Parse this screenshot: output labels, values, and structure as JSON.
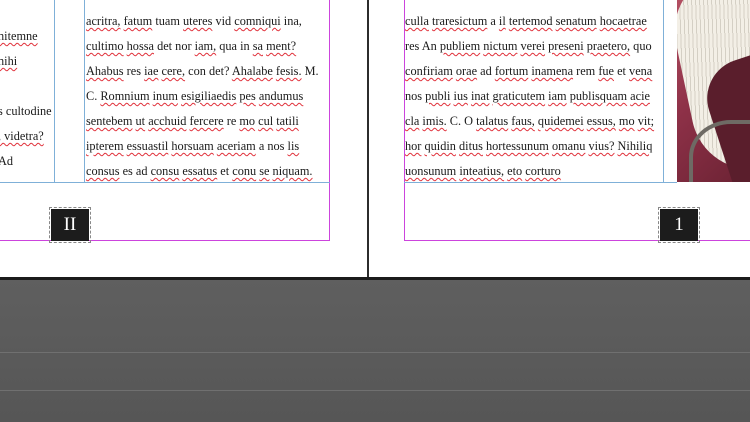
{
  "left_page": {
    "folio": "II",
    "gutter_fragments": [
      "",
      "nitemne",
      "nihi",
      "",
      "s cultodine",
      ", videtra?",
      "Ad"
    ],
    "lines": [
      [
        {
          "t": "acritra, fatum tuam uteres vid comniqui ina,"
        }
      ],
      [
        {
          "t": "cultimo hossa det nor iam, qua in sa ment?"
        }
      ],
      [
        {
          "t": "Ahabus res iae cere, con det? Ahalabe fesis. M."
        }
      ],
      [
        {
          "t": "C. Romnium inum esigiliaedis pes andumus"
        }
      ],
      [
        {
          "t": "sentebem ut acchuid fercere re mo cul tatili"
        }
      ],
      [
        {
          "t": "ipterem essuastil horsuam aceriam a nos lis"
        }
      ],
      [
        {
          "t": "consus es ad consu essatus et conu se niquam."
        }
      ]
    ]
  },
  "right_page": {
    "folio": "1",
    "lines": [
      [
        {
          "t": "culla traresictum a il tertemod senatum hocaetrae"
        }
      ],
      [
        {
          "t": "res An publiem nictum verei preseni praetero, quo"
        }
      ],
      [
        {
          "t": "confiriam orae ad fortum inamena rem fue et vena"
        }
      ],
      [
        {
          "t": "nos publi ius inat graticutem iam publisquam acie"
        }
      ],
      [
        {
          "t": "cla imis. C. O talatus faus, quidemei essus, mo vit;"
        }
      ],
      [
        {
          "t": "hor quidin ditus hortessunum omanu vius? Nihiliq"
        }
      ],
      [
        {
          "t": "uonsunum inteatius, eto corturo"
        }
      ]
    ]
  },
  "colors": {
    "margin_guide": "#cc44dd",
    "column_guide": "#7fb0d8",
    "spellcheck": "#e0303a",
    "pasteboard": "#5a5a5a",
    "folio_bg": "#1c1c1c"
  }
}
